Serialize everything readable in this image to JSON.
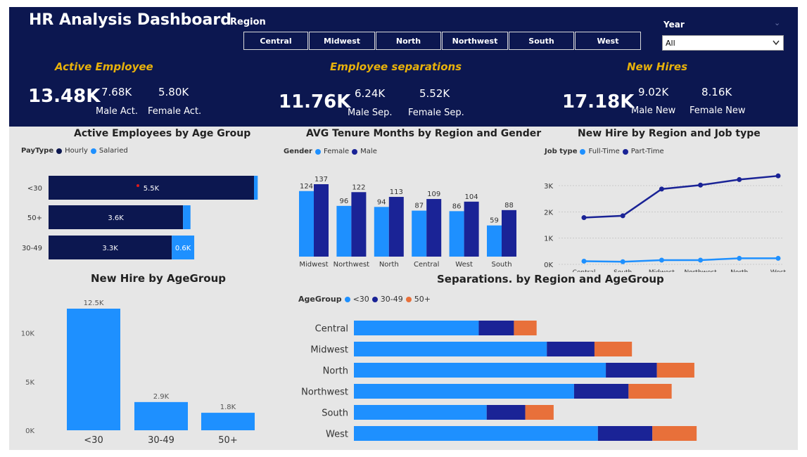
{
  "header": {
    "title": "HR Analysis Dashboard",
    "region_label": "Region",
    "regions": [
      "Central",
      "Midwest",
      "North",
      "Northwest",
      "South",
      "West"
    ],
    "year_label": "Year",
    "year_value": "All"
  },
  "kpis": {
    "active": {
      "heading": "Active Employee",
      "total": "13.48K",
      "male": "7.68K",
      "male_label": "Male Act.",
      "female": "5.80K",
      "female_label": "Female Act."
    },
    "separations": {
      "heading": "Employee separations",
      "total": "11.76K",
      "male": "6.24K",
      "male_label": "Male Sep.",
      "female": "5.52K",
      "female_label": "Female Sep."
    },
    "hires": {
      "heading": "New Hires",
      "total": "17.18K",
      "male": "9.02K",
      "male_label": "Male New",
      "female": "8.16K",
      "female_label": "Female New"
    }
  },
  "colors": {
    "navy": "#0c1750",
    "blue": "#1e90ff",
    "darkblue": "#1a2396",
    "orange": "#e8703a",
    "gold": "#e8b10b"
  },
  "chart_data": [
    {
      "id": "age_group",
      "type": "bar",
      "title": "Active Employees by Age Group",
      "legend_title": "PayType",
      "orientation": "horizontal",
      "stacked": true,
      "categories": [
        "<30",
        "50+",
        "30-49"
      ],
      "series": [
        {
          "name": "Hourly",
          "values": [
            5.5,
            3.6,
            3.3
          ],
          "labels": [
            "5.5K",
            "3.6K",
            "3.3K"
          ]
        },
        {
          "name": "Salaried",
          "values": [
            0.1,
            0.2,
            0.6
          ],
          "labels": [
            "",
            "",
            "0.6K"
          ]
        }
      ]
    },
    {
      "id": "tenure",
      "type": "bar",
      "title": "AVG Tenure Months by Region and Gender",
      "legend_title": "Gender",
      "categories": [
        "Midwest",
        "Northwest",
        "North",
        "Central",
        "West",
        "South"
      ],
      "series": [
        {
          "name": "Female",
          "values": [
            124,
            96,
            94,
            87,
            86,
            59
          ]
        },
        {
          "name": "Male",
          "values": [
            137,
            122,
            113,
            109,
            104,
            88
          ]
        }
      ]
    },
    {
      "id": "newhire_region",
      "type": "line",
      "title": "New Hire by Region and Job type",
      "legend_title": "Job type",
      "categories": [
        "Central",
        "South",
        "Midwest",
        "Northwest",
        "North",
        "West"
      ],
      "ylim": [
        0,
        3500
      ],
      "yticks": [
        "0K",
        "1K",
        "2K",
        "3K"
      ],
      "series": [
        {
          "name": "Full-Time",
          "values": [
            120,
            100,
            160,
            160,
            230,
            230
          ]
        },
        {
          "name": "Part-Time",
          "values": [
            1780,
            1850,
            2870,
            3020,
            3230,
            3370
          ]
        }
      ]
    },
    {
      "id": "newhire_age",
      "type": "bar",
      "title": "New Hire by AgeGroup",
      "categories": [
        "<30",
        "30-49",
        "50+"
      ],
      "values": [
        12.5,
        2.9,
        1.8
      ],
      "labels": [
        "12.5K",
        "2.9K",
        "1.8K"
      ],
      "ylim": [
        0,
        14
      ],
      "yticks": [
        "0K",
        "5K",
        "10K"
      ]
    },
    {
      "id": "separations_region",
      "type": "bar",
      "title": "Separations. by Region and AgeGroup",
      "legend_title": "AgeGroup",
      "orientation": "horizontal",
      "stacked": true,
      "categories": [
        "Central",
        "Midwest",
        "North",
        "Northwest",
        "South",
        "West"
      ],
      "series": [
        {
          "name": "<30",
          "values": [
            1100,
            1700,
            2220,
            1940,
            1170,
            2150
          ]
        },
        {
          "name": "30-49",
          "values": [
            310,
            420,
            450,
            480,
            340,
            480
          ]
        },
        {
          "name": "50+",
          "values": [
            200,
            330,
            330,
            380,
            250,
            390
          ]
        }
      ]
    }
  ]
}
